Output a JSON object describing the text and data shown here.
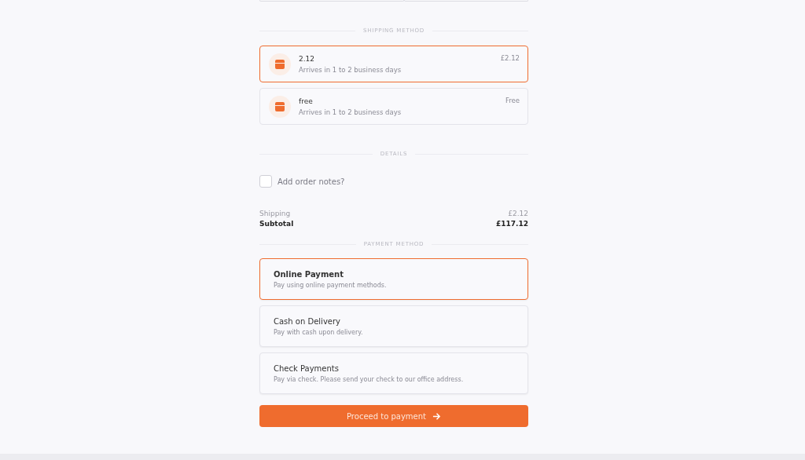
{
  "shipping_heading": "SHIPPING METHOD",
  "shipping_methods": [
    {
      "name": "2.12",
      "description": "Arrives in 1 to 2 business days",
      "price": "£2.12",
      "selected": true
    },
    {
      "name": "free",
      "description": "Arrives in 1 to 2 business days",
      "price": "Free",
      "selected": false
    }
  ],
  "details_heading": "DETAILS",
  "order_notes": {
    "label": "Add order notes?",
    "checked": false
  },
  "totals": [
    {
      "label": "Shipping",
      "value": "£2.12",
      "kind": "line"
    },
    {
      "label": "Subtotal",
      "value": "£117.12",
      "kind": "total"
    }
  ],
  "payment_heading": "PAYMENT METHOD",
  "payment_methods": [
    {
      "name": "Online Payment",
      "description": "Pay using online payment methods.",
      "selected": true
    },
    {
      "name": "Cash on Delivery",
      "description": "Pay with cash upon delivery.",
      "selected": false
    },
    {
      "name": "Check Payments",
      "description": "Pay via check. Please send your check to our office address.",
      "selected": false
    }
  ],
  "proceed_button": "Proceed to payment"
}
